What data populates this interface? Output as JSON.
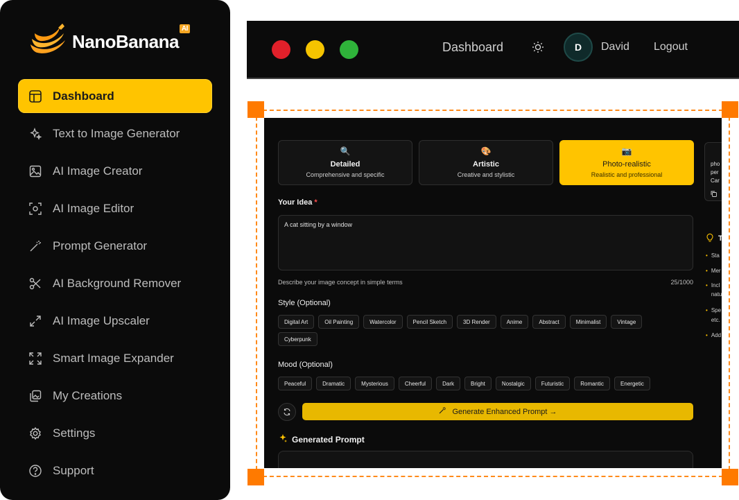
{
  "brand": {
    "name": "NanoBanana",
    "badge": "AI"
  },
  "sidebar": {
    "items": [
      {
        "label": "Dashboard",
        "icon": "layout-icon",
        "active": true
      },
      {
        "label": "Text to Image Generator",
        "icon": "sparkles-icon"
      },
      {
        "label": "AI Image Creator",
        "icon": "image-icon"
      },
      {
        "label": "AI Image Editor",
        "icon": "scan-edit-icon"
      },
      {
        "label": "Prompt Generator",
        "icon": "wand-icon"
      },
      {
        "label": "AI Background Remover",
        "icon": "scissors-icon"
      },
      {
        "label": "AI Image Upscaler",
        "icon": "expand-arrows-icon"
      },
      {
        "label": "Smart Image Expander",
        "icon": "maximize-icon"
      },
      {
        "label": "My Creations",
        "icon": "gallery-icon"
      },
      {
        "label": "Settings",
        "icon": "gear-icon"
      },
      {
        "label": "Support",
        "icon": "help-circle-icon"
      }
    ]
  },
  "topbar": {
    "title": "Dashboard",
    "avatar_initial": "D",
    "user_name": "David",
    "logout": "Logout",
    "dots": [
      "#e0202a",
      "#f5c400",
      "#2fb33a"
    ]
  },
  "modes": [
    {
      "emoji": "🔍",
      "title": "Detailed",
      "subtitle": "Comprehensive and specific",
      "active": false
    },
    {
      "emoji": "🎨",
      "title": "Artistic",
      "subtitle": "Creative and stylistic",
      "active": false
    },
    {
      "emoji": "📷",
      "title": "Photo-realistic",
      "subtitle": "Realistic and professional",
      "active": true
    }
  ],
  "idea": {
    "label": "Your Idea",
    "required_mark": "*",
    "value": "A cat sitting by a window",
    "hint": "Describe your image concept in simple terms",
    "count": "25/1000"
  },
  "style": {
    "label": "Style (Optional)",
    "options": [
      "Digital Art",
      "Oil Painting",
      "Watercolor",
      "Pencil Sketch",
      "3D Render",
      "Anime",
      "Abstract",
      "Minimalist",
      "Vintage",
      "Cyberpunk"
    ]
  },
  "mood": {
    "label": "Mood (Optional)",
    "options": [
      "Peaceful",
      "Dramatic",
      "Mysterious",
      "Cheerful",
      "Dark",
      "Bright",
      "Nostalgic",
      "Futuristic",
      "Romantic",
      "Energetic"
    ]
  },
  "generate_button": "Generate Enhanced Prompt →",
  "generated_label": "Generated Prompt",
  "side_card_lines": [
    "pho",
    "per",
    "Car"
  ],
  "tips": {
    "head": "T",
    "items": [
      "Sta",
      "Mer",
      "Incl",
      "natu",
      "Spe",
      "etc.",
      "Add"
    ]
  },
  "colors": {
    "accent": "#ffc400",
    "frame": "#ff7a00",
    "bg": "#0b0b0b"
  }
}
